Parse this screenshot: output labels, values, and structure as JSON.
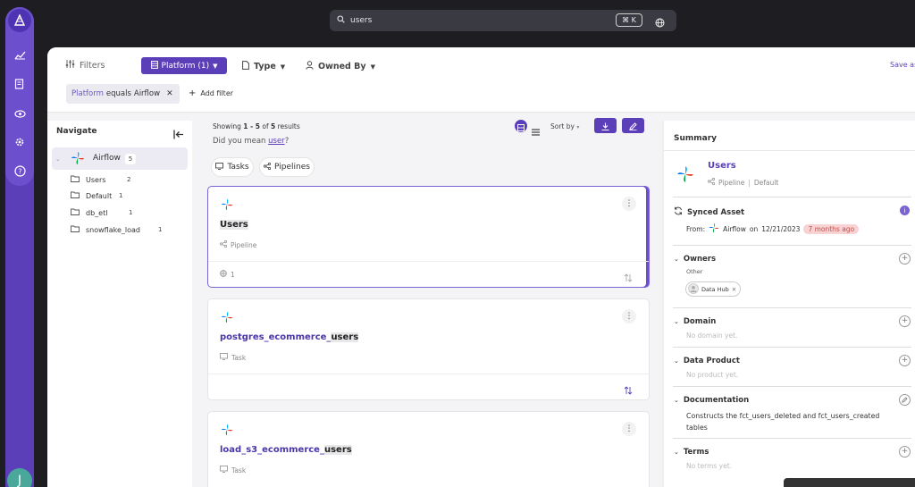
{
  "search": {
    "query": "users",
    "shortcut": "⌘ K"
  },
  "filters": {
    "title": "Filters",
    "platform_label": "Platform (1)",
    "type_label": "Type",
    "owned_by_label": "Owned By",
    "save_label": "Save as",
    "chip": {
      "field": "Platform",
      "operator": "equals",
      "value": "Airflow"
    },
    "add_filter": "Add filter"
  },
  "navigate": {
    "title": "Navigate",
    "root": {
      "label": "Airflow",
      "count": "5"
    },
    "folders": [
      {
        "label": "Users",
        "count": "2"
      },
      {
        "label": "Default",
        "count": "1"
      },
      {
        "label": "db_etl",
        "count": "1"
      },
      {
        "label": "snowflake_load",
        "count": "1"
      }
    ]
  },
  "results": {
    "showing_prefix": "Showing",
    "showing_range": "1 - 5",
    "showing_of": "of",
    "showing_total": "5",
    "showing_suffix": "results",
    "did_you_mean": "Did you mean",
    "suggestion": "user",
    "sort_label": "Sort by",
    "tabs": [
      {
        "label": "Tasks"
      },
      {
        "label": "Pipelines"
      }
    ],
    "cards": [
      {
        "title": "Users",
        "subtype": "Pipeline",
        "count": "1"
      },
      {
        "title_prefix": "postgres_ecommerce_",
        "title_hl": "users",
        "subtype": "Task"
      },
      {
        "title_prefix": "load_s3_ecommerce_",
        "title_hl": "users",
        "subtype": "Task"
      }
    ]
  },
  "summary": {
    "title": "Summary",
    "entity_name": "Users",
    "entity_type": "Pipeline",
    "entity_sep": "|",
    "entity_container": "Default",
    "synced": {
      "title": "Synced Asset",
      "from": "From:",
      "platform": "Airflow",
      "on": "on",
      "date": "12/21/2023",
      "ago": "7 months ago"
    },
    "owners": {
      "title": "Owners",
      "group": "Other",
      "owner": "Data Hub"
    },
    "domain": {
      "title": "Domain",
      "empty": "No domain yet."
    },
    "data_product": {
      "title": "Data Product",
      "empty": "No product yet."
    },
    "documentation": {
      "title": "Documentation",
      "text": "Constructs the fct_users_deleted and fct_users_created tables"
    },
    "terms": {
      "title": "Terms",
      "empty": "No terms yet."
    }
  },
  "user": {
    "initial": "J"
  },
  "colors": {
    "accent": "#5b3fb8",
    "highlight": "#6b4fcc",
    "link": "#4b35a8",
    "warning_bg": "#f8d3d3",
    "warning_text": "#c0504d"
  }
}
